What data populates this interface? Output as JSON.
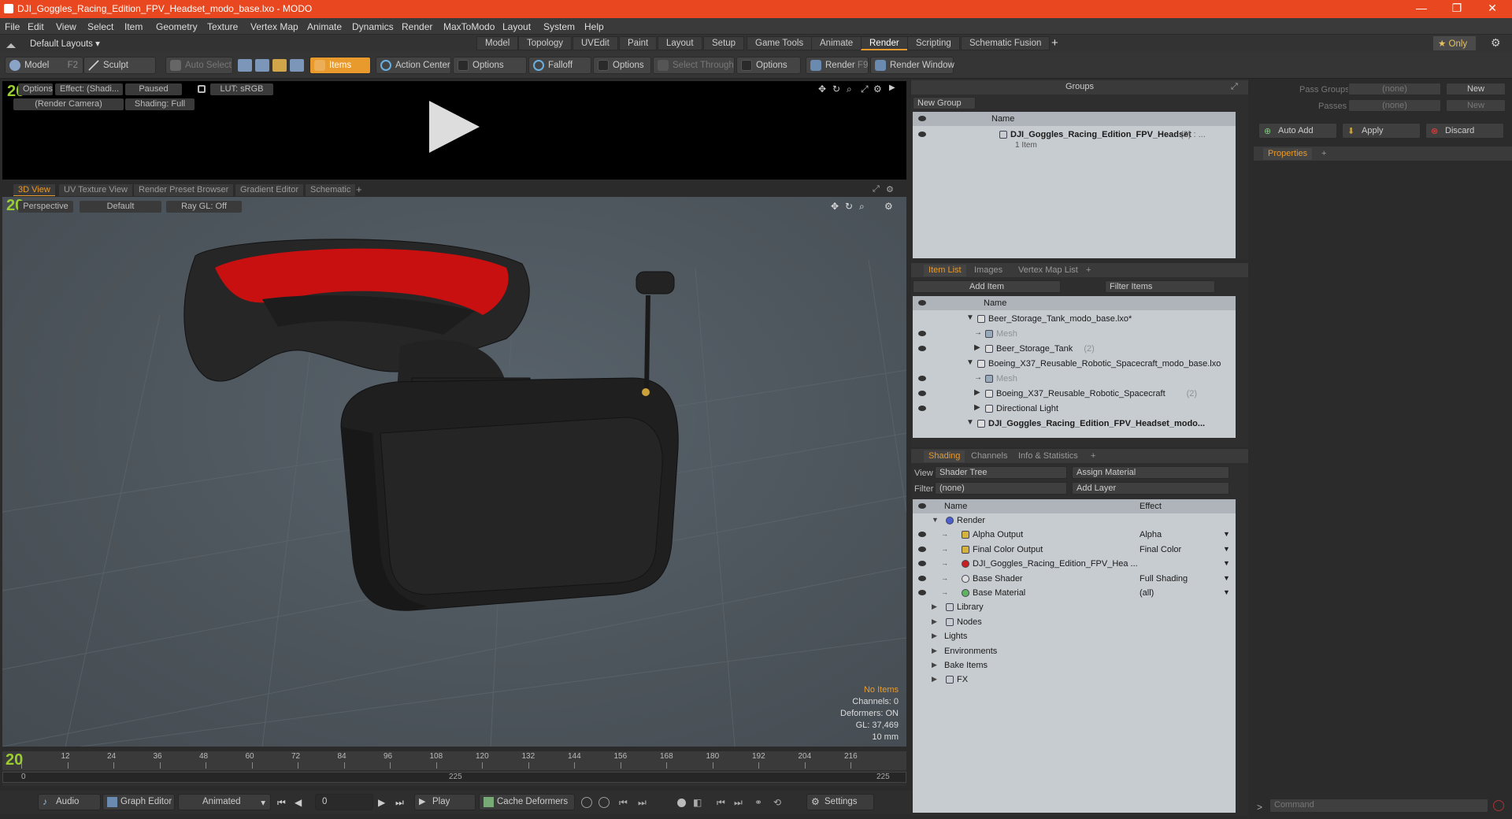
{
  "window": {
    "title": "DJI_Goggles_Racing_Edition_FPV_Headset_modo_base.lxo - MODO",
    "minimize": "—",
    "maximize": "❐",
    "close": "✕"
  },
  "menu": [
    "File",
    "Edit",
    "View",
    "Select",
    "Item",
    "Geometry",
    "Texture",
    "Vertex Map",
    "Animate",
    "Dynamics",
    "Render",
    "MaxToModo",
    "Layout",
    "System",
    "Help"
  ],
  "layouts": {
    "selector": "Default Layouts ▾",
    "tabs": [
      "Model",
      "Topology",
      "UVEdit",
      "Paint",
      "Layout",
      "Setup",
      "Game Tools",
      "Animate",
      "Render",
      "Scripting",
      "Schematic Fusion"
    ],
    "active": "Render",
    "add": "+",
    "only": "★ Only",
    "gear": "⚙"
  },
  "toolbar": {
    "model": "Model",
    "model_key": "F2",
    "sculpt": "Sculpt",
    "auto_select": "Auto Select",
    "items": "Items",
    "action_center": "Action Center",
    "options1": "Options",
    "falloff": "Falloff",
    "options2": "Options",
    "select_through": "Select Through",
    "options3": "Options",
    "render": "Render",
    "render_key": "F9",
    "render_window": "Render Window"
  },
  "render_view": {
    "options": "Options",
    "effect": "Effect: (Shadi...",
    "paused": "Paused",
    "lut": "LUT: sRGB",
    "camera": "(Render Camera)",
    "shading": "Shading: Full"
  },
  "viewport_tabs": [
    "3D View",
    "UV Texture View",
    "Render Preset Browser",
    "Gradient Editor",
    "Schematic"
  ],
  "viewport_tabs_add": "+",
  "viewport": {
    "perspective": "Perspective",
    "default": "Default",
    "raygl": "Ray GL: Off"
  },
  "hud": {
    "no_items": "No Items",
    "channels": "Channels: 0",
    "deformers": "Deformers: ON",
    "gl": "GL: 37,469",
    "scale": "10 mm"
  },
  "timeline": {
    "ticks": [
      "0",
      "12",
      "24",
      "36",
      "48",
      "60",
      "72",
      "84",
      "96",
      "108",
      "120",
      "132",
      "144",
      "156",
      "168",
      "180",
      "192",
      "204",
      "216"
    ],
    "start": "0",
    "mid": "225",
    "end": "225"
  },
  "playbar": {
    "audio": "Audio",
    "graph_editor": "Graph Editor",
    "animated": "Animated",
    "frame": "0",
    "play": "Play",
    "cache": "Cache Deformers",
    "settings": "Settings"
  },
  "groups": {
    "title": "Groups",
    "new_group": "New Group",
    "col_name": "Name",
    "item_name": "DJI_Goggles_Racing_Edition_FPV_Headset",
    "item_count": "(3) : ...",
    "item_sub": "1 Item"
  },
  "item_list": {
    "tabs": [
      "Item List",
      "Images",
      "Vertex Map List"
    ],
    "add": "+",
    "add_item": "Add Item",
    "filter": "Filter Items",
    "col_name": "Name",
    "rows": [
      {
        "label": "Beer_Storage_Tank_modo_base.lxo*",
        "indent": 0
      },
      {
        "label": "Mesh",
        "indent": 2,
        "dim": true
      },
      {
        "label": "Beer_Storage_Tank",
        "suffix": "(2)",
        "indent": 2
      },
      {
        "label": "Boeing_X37_Reusable_Robotic_Spacecraft_modo_base.lxo",
        "indent": 0
      },
      {
        "label": "Mesh",
        "indent": 2,
        "dim": true
      },
      {
        "label": "Boeing_X37_Reusable_Robotic_Spacecraft",
        "suffix": "(2)",
        "indent": 2
      },
      {
        "label": "Directional Light",
        "indent": 2
      },
      {
        "label": "DJI_Goggles_Racing_Edition_FPV_Headset_modo...",
        "indent": 0,
        "bold": true
      }
    ]
  },
  "shading": {
    "tabs": [
      "Shading",
      "Channels",
      "Info & Statistics"
    ],
    "add": "+",
    "view_label": "View",
    "view_value": "Shader Tree",
    "assign": "Assign Material",
    "filter_label": "Filter",
    "filter_value": "(none)",
    "add_layer": "Add Layer",
    "col_name": "Name",
    "col_effect": "Effect",
    "rows": [
      {
        "label": "Render",
        "effect": "",
        "indent": 1
      },
      {
        "label": "Alpha Output",
        "effect": "Alpha",
        "indent": 2
      },
      {
        "label": "Final Color Output",
        "effect": "Final Color",
        "indent": 2
      },
      {
        "label": "DJI_Goggles_Racing_Edition_FPV_Hea ...",
        "effect": "",
        "indent": 2
      },
      {
        "label": "Base Shader",
        "effect": "Full Shading",
        "indent": 2
      },
      {
        "label": "Base Material",
        "effect": "(all)",
        "indent": 2
      },
      {
        "label": "Library",
        "effect": "",
        "indent": 1
      },
      {
        "label": "Nodes",
        "effect": "",
        "indent": 1
      },
      {
        "label": "Lights",
        "effect": "",
        "indent": 0
      },
      {
        "label": "Environments",
        "effect": "",
        "indent": 0
      },
      {
        "label": "Bake Items",
        "effect": "",
        "indent": 0
      },
      {
        "label": "FX",
        "effect": "",
        "indent": 0
      }
    ]
  },
  "properties": {
    "pass_groups": "Pass Groups",
    "pass_groups_val": "(none)",
    "passes": "Passes",
    "passes_val": "(none)",
    "new1": "New",
    "new2": "New",
    "auto_add": "Auto Add",
    "apply": "Apply",
    "discard": "Discard",
    "tab": "Properties",
    "add": "+"
  },
  "command": {
    "placeholder": "Command",
    "arrow": ">"
  },
  "colors": {
    "accent": "#e89a2c",
    "titlebar": "#e8471f",
    "red_pad": "#c81010"
  }
}
